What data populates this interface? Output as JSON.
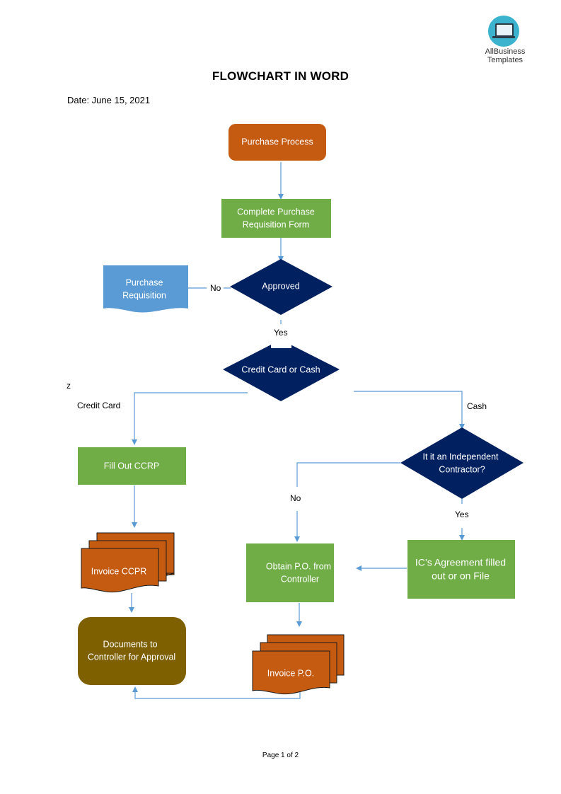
{
  "logo": {
    "brand_line1": "AllBusiness",
    "brand_line2": "Templates",
    "icon": "laptop-icon"
  },
  "document": {
    "title": "FLOWCHART IN WORD",
    "date_label": "Date:  June 15, 2021",
    "stray_text": "z",
    "footer": "Page 1 of 2"
  },
  "colors": {
    "orange": "#c55a11",
    "green": "#70ad47",
    "navy": "#002060",
    "light_blue": "#5b9bd5",
    "olive": "#7f6000",
    "connector": "#5b9bd5"
  },
  "flowchart": {
    "nodes": {
      "purchase_process": {
        "line1": "Purchase Process"
      },
      "complete_form": {
        "line1": "Complete Purchase",
        "line2": "Requisition Form"
      },
      "approved": {
        "line1": "Approved"
      },
      "purchase_requisition": {
        "line1": "Purchase",
        "line2": "Requisition"
      },
      "cc_or_cash": {
        "line1": "Credit Card or Cash"
      },
      "fill_ccrp": {
        "line1": "Fill Out CCRP"
      },
      "independent": {
        "line1": "It it an Independent",
        "line2": "Contractor?"
      },
      "invoice_ccpr": {
        "line1": "Invoice CCPR"
      },
      "obtain_po": {
        "line1": "Obtain P.O. from",
        "line2": "Controller"
      },
      "ic_agreement": {
        "line1": "IC’s Agreement filled",
        "line2": "out or on File"
      },
      "documents_controller": {
        "line1": "Documents to",
        "line2": "Controller for Approval"
      },
      "invoice_po": {
        "line1": "Invoice P.O."
      }
    },
    "labels": {
      "no_approved": "No",
      "yes_approved": "Yes",
      "credit_card": "Credit Card",
      "cash": "Cash",
      "no_contractor": "No",
      "yes_contractor": "Yes"
    }
  }
}
